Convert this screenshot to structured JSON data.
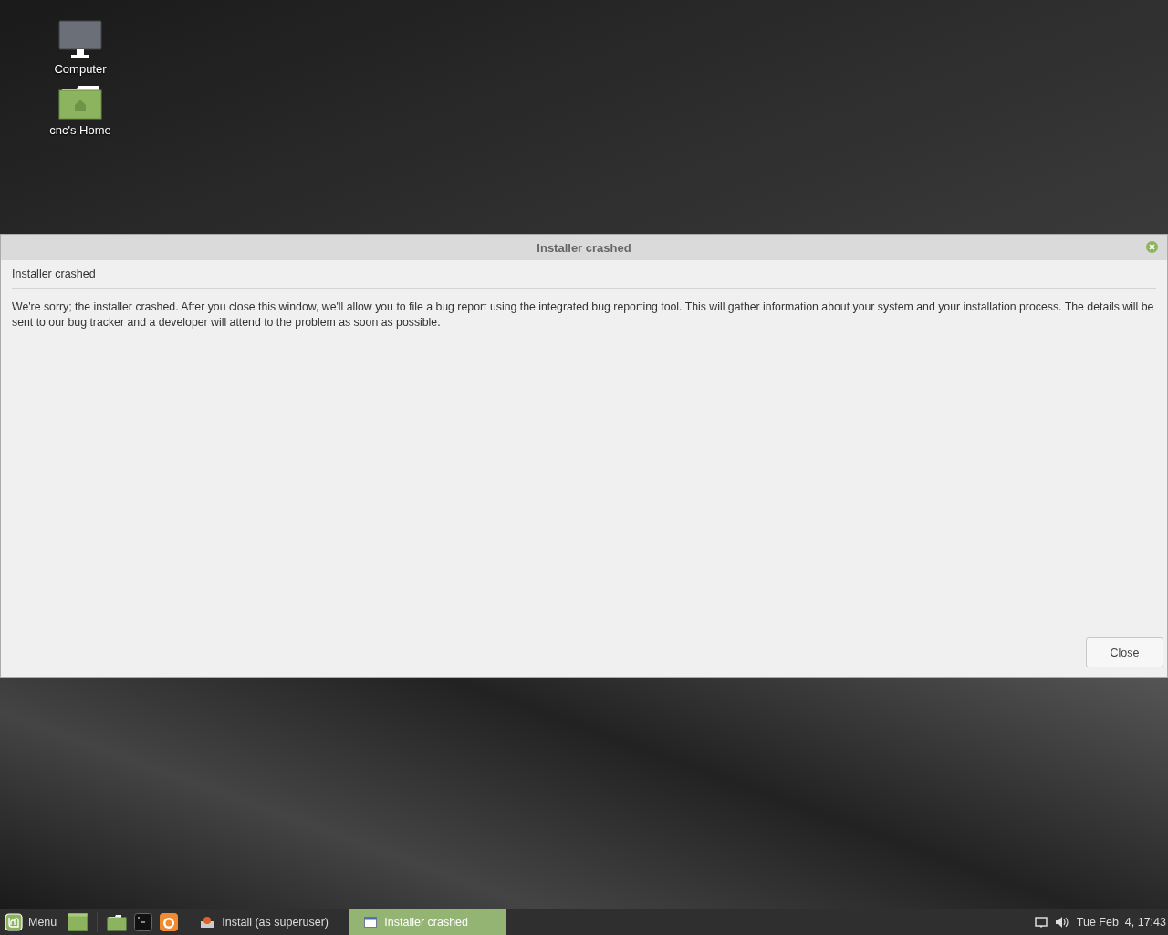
{
  "desktop_icons": [
    {
      "kind": "computer",
      "label": "Computer"
    },
    {
      "kind": "home",
      "label": "cnc's Home"
    }
  ],
  "dialog": {
    "title": "Installer crashed",
    "heading": "Installer crashed",
    "message": "We're sorry; the installer crashed. After you close this window, we'll allow you to file a bug report using the integrated bug reporting tool. This will gather information about your system and your installation process. The details will be sent to our bug tracker and a developer will attend to the problem as soon as possible.",
    "buttons": [
      "Close"
    ]
  },
  "taskbar": {
    "menu_label": "Menu",
    "launchers": [
      {
        "kind": "desktop"
      },
      {
        "kind": "files"
      },
      {
        "kind": "terminal"
      },
      {
        "kind": "browser"
      }
    ],
    "windows": [
      {
        "kind": "installer",
        "label": "Install (as superuser)",
        "selected": false
      },
      {
        "kind": "dialog",
        "label": "Installer crashed",
        "selected": true
      }
    ],
    "clock": "Tue Feb  4, 17:43"
  }
}
